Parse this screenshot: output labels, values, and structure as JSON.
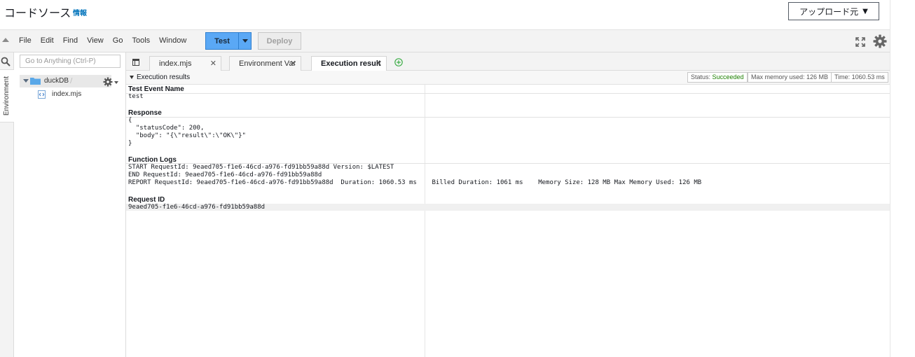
{
  "header": {
    "title": "コードソース",
    "info_link": "情報",
    "upload_button": "アップロード元"
  },
  "toolbar": {
    "menus": [
      "File",
      "Edit",
      "Find",
      "View",
      "Go",
      "Tools",
      "Window"
    ],
    "test_label": "Test",
    "deploy_label": "Deploy"
  },
  "sidebar": {
    "rail_label": "Environment",
    "search_placeholder": "Go to Anything (Ctrl-P)",
    "folder_name": "duckDB",
    "folder_suffix": "/",
    "file_name": "index.mjs"
  },
  "tabs": [
    {
      "label": "index.mjs",
      "active": false
    },
    {
      "label": "Environment Var",
      "active": false
    },
    {
      "label": "Execution result",
      "active": true
    }
  ],
  "results": {
    "title": "Execution results",
    "status_label": "Status:",
    "status_value": "Succeeded",
    "max_memory": "Max memory used: 126 MB",
    "time": "Time: 1060.53 ms",
    "test_event_label": "Test Event Name",
    "test_event_value": "test",
    "response_label": "Response",
    "response_lines": [
      "{",
      "  \"statusCode\": 200,",
      "  \"body\": \"{\\\"result\\\":\\\"OK\\\"}\"",
      "}"
    ],
    "function_logs_label": "Function Logs",
    "log_lines": [
      "START RequestId: 9eaed705-f1e6-46cd-a976-fd91bb59a88d Version: $LATEST",
      "END RequestId: 9eaed705-f1e6-46cd-a976-fd91bb59a88d",
      "REPORT RequestId: 9eaed705-f1e6-46cd-a976-fd91bb59a88d  Duration: 1060.53 ms    Billed Duration: 1061 ms    Memory Size: 128 MB Max Memory Used: 126 MB"
    ],
    "request_id_label": "Request ID",
    "request_id_value": "9eaed705-f1e6-46cd-a976-fd91bb59a88d"
  },
  "colors": {
    "test_button": "#5aa8f5",
    "status_ok": "#1d8102",
    "link": "#0073bb"
  }
}
